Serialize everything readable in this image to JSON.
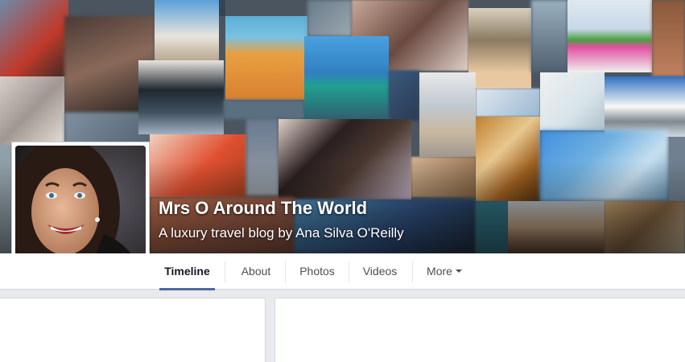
{
  "page": {
    "title": "Mrs O Around The World",
    "subtitle": "A luxury travel blog by Ana Silva O'Reilly"
  },
  "nav": {
    "tabs": [
      {
        "label": "Timeline",
        "active": true
      },
      {
        "label": "About",
        "active": false
      },
      {
        "label": "Photos",
        "active": false
      },
      {
        "label": "Videos",
        "active": false
      },
      {
        "label": "More",
        "active": false
      }
    ]
  },
  "colors": {
    "accent": "#4e69a2",
    "background": "#e9eaed",
    "nav_text": "#4b4f56"
  },
  "icons": {
    "more_dropdown": "caret-down-icon"
  }
}
